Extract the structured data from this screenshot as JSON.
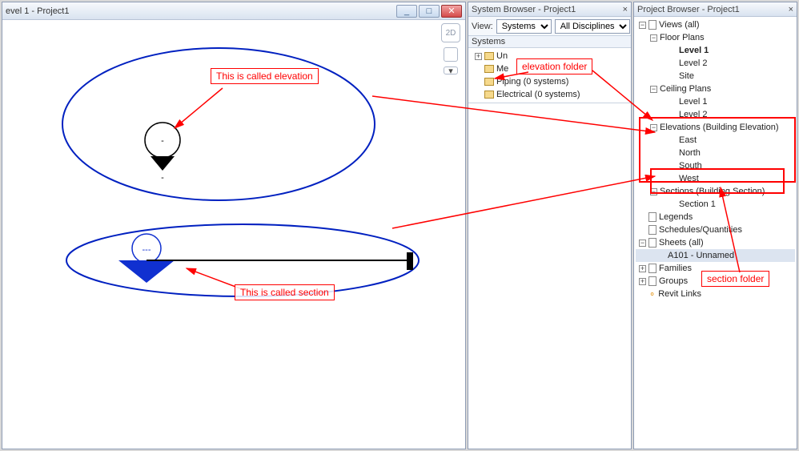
{
  "viewport": {
    "title": "evel 1 - Project1"
  },
  "annotations": {
    "elevation_label": "This is called elevation",
    "section_label": "This is called section",
    "elevation_folder": "elevation folder",
    "section_folder": "section folder"
  },
  "system_browser": {
    "title": "System Browser - Project1",
    "view_label": "View:",
    "view_dropdown": "Systems",
    "discipline_dropdown": "All Disciplines",
    "header": "Systems",
    "items": [
      {
        "label": "Un",
        "expander": "+",
        "icon": "folder"
      },
      {
        "label": "Me",
        "expander": "",
        "icon": "folder"
      },
      {
        "label": "Piping (0 systems)",
        "expander": "",
        "icon": "folder"
      },
      {
        "label": "Electrical (0 systems)",
        "expander": "",
        "icon": "folder"
      }
    ]
  },
  "project_browser": {
    "title": "Project Browser - Project1",
    "items": [
      {
        "label": "Views (all)",
        "indent": 4,
        "expander": "-",
        "icon": "doc",
        "bold": false
      },
      {
        "label": "Floor Plans",
        "indent": 18,
        "expander": "-",
        "icon": "",
        "bold": false
      },
      {
        "label": "Level 1",
        "indent": 42,
        "expander": "leaf",
        "icon": "",
        "bold": true
      },
      {
        "label": "Level 2",
        "indent": 42,
        "expander": "leaf",
        "icon": "",
        "bold": false
      },
      {
        "label": "Site",
        "indent": 42,
        "expander": "leaf",
        "icon": "",
        "bold": false
      },
      {
        "label": "Ceiling Plans",
        "indent": 18,
        "expander": "-",
        "icon": "",
        "bold": false
      },
      {
        "label": "Level 1",
        "indent": 42,
        "expander": "leaf",
        "icon": "",
        "bold": false
      },
      {
        "label": "Level 2",
        "indent": 42,
        "expander": "leaf",
        "icon": "",
        "bold": false
      },
      {
        "label": "Elevations (Building Elevation)",
        "indent": 18,
        "expander": "-",
        "icon": "",
        "bold": false
      },
      {
        "label": "East",
        "indent": 42,
        "expander": "leaf",
        "icon": "",
        "bold": false
      },
      {
        "label": "North",
        "indent": 42,
        "expander": "leaf",
        "icon": "",
        "bold": false
      },
      {
        "label": "South",
        "indent": 42,
        "expander": "leaf",
        "icon": "",
        "bold": false
      },
      {
        "label": "West",
        "indent": 42,
        "expander": "leaf",
        "icon": "",
        "bold": false
      },
      {
        "label": "Sections (Building Section)",
        "indent": 18,
        "expander": "-",
        "icon": "",
        "bold": false
      },
      {
        "label": "Section 1",
        "indent": 42,
        "expander": "leaf",
        "icon": "",
        "bold": false
      },
      {
        "label": "Legends",
        "indent": 4,
        "expander": "leaf",
        "icon": "doc",
        "bold": false
      },
      {
        "label": "Schedules/Quantities",
        "indent": 4,
        "expander": "leaf",
        "icon": "doc",
        "bold": false
      },
      {
        "label": "Sheets (all)",
        "indent": 4,
        "expander": "-",
        "icon": "doc",
        "bold": false
      },
      {
        "label": "A101 - Unnamed",
        "indent": 28,
        "expander": "leaf",
        "icon": "",
        "bold": false,
        "selected": true
      },
      {
        "label": "Families",
        "indent": 4,
        "expander": "+",
        "icon": "doc",
        "bold": false
      },
      {
        "label": "Groups",
        "indent": 4,
        "expander": "+",
        "icon": "doc",
        "bold": false
      },
      {
        "label": "Revit Links",
        "indent": 4,
        "expander": "leaf",
        "icon": "link",
        "bold": false
      }
    ]
  }
}
